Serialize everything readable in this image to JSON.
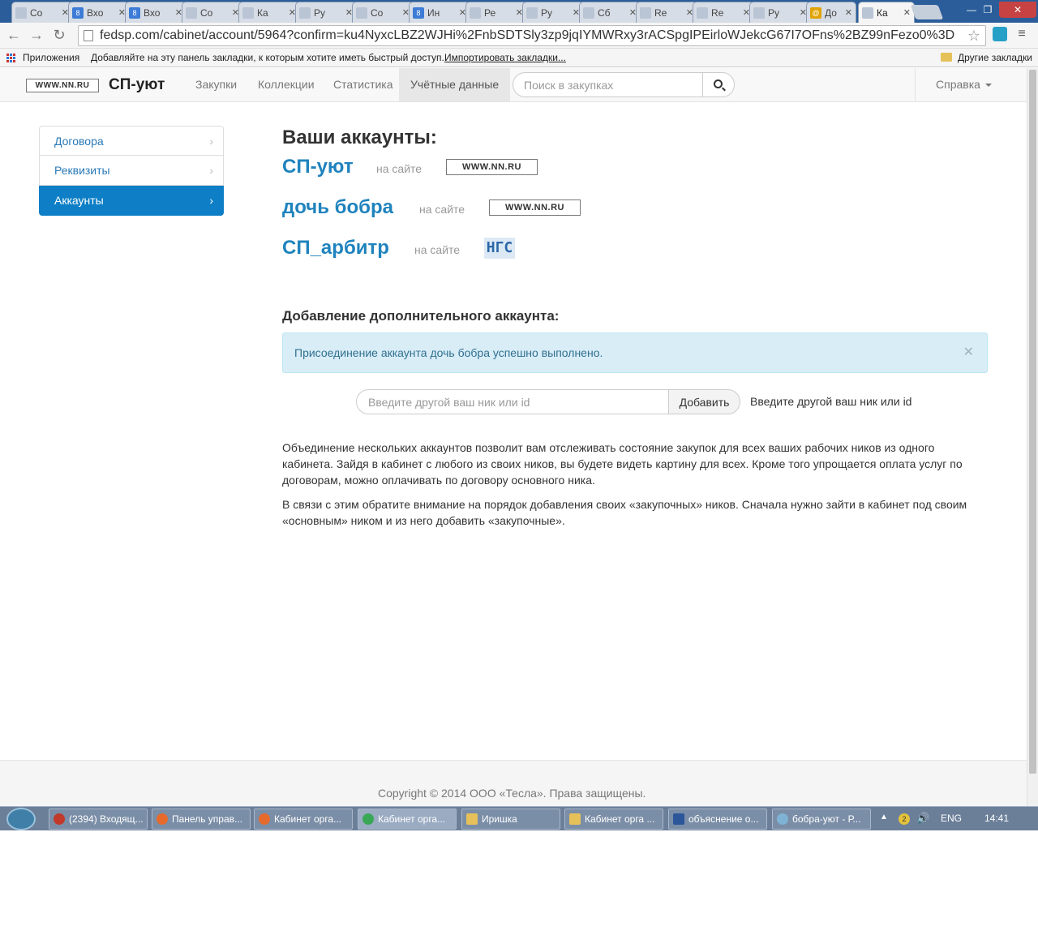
{
  "browser": {
    "tabs": [
      {
        "label": "Со",
        "icon": "page-icon"
      },
      {
        "label": "Вхо",
        "icon": "mail-icon"
      },
      {
        "label": "Вхо",
        "icon": "mail-icon"
      },
      {
        "label": "Со",
        "icon": "page-icon"
      },
      {
        "label": "Ка",
        "icon": "cart-icon"
      },
      {
        "label": "Ру",
        "icon": "page-icon"
      },
      {
        "label": "Со",
        "icon": "page-icon"
      },
      {
        "label": "Ин",
        "icon": "mail-icon"
      },
      {
        "label": "Ре",
        "icon": "document-icon"
      },
      {
        "label": "Ру",
        "icon": "page-icon"
      },
      {
        "label": "Сб",
        "icon": "page-icon"
      },
      {
        "label": "Re",
        "icon": "page-icon"
      },
      {
        "label": "Re",
        "icon": "page-icon"
      },
      {
        "label": "Ру",
        "icon": "page-icon"
      },
      {
        "label": "До",
        "icon": "at-icon"
      },
      {
        "label": "Ка",
        "icon": "cart-icon"
      }
    ],
    "url": "fedsp.com/cabinet/account/5964?confirm=ku4NyxcLBZ2WJHi%2FnbSDTSly3zp9jqIYMWRxy3rACSpgIPEirloWJekcG67I7OFns%2BZ99nFezo0%3D",
    "bookmarks": {
      "apps": "Приложения",
      "hint": "Добавляйте на эту панель закладки, к которым хотите иметь быстрый доступ.",
      "import": "Импортировать закладки...",
      "other": "Другие закладки"
    }
  },
  "navbar": {
    "logo_text": "WWW.NN.RU",
    "brand": "СП-уют",
    "items": [
      "Закупки",
      "Коллекции",
      "Статистика",
      "Учётные данные"
    ],
    "active_item": "Учётные данные",
    "search_placeholder": "Поиск в закупках",
    "help": "Справка"
  },
  "sidebar": {
    "items": [
      "Договора",
      "Реквизиты",
      "Аккаунты"
    ],
    "active": "Аккаунты"
  },
  "main": {
    "heading": "Ваши аккаунты:",
    "site_label": "на сайте",
    "accounts": [
      {
        "name": "СП-уют",
        "site_logo": "WWW.NN.RU"
      },
      {
        "name": "дочь бобра",
        "site_logo": "WWW.NN.RU"
      },
      {
        "name": "СП_арбитр",
        "site_logo": "НГС"
      }
    ],
    "add_heading": "Добавление дополнительного аккаунта:",
    "alert": "Присоединение аккаунта дочь бобра успешно выполнено.",
    "input_placeholder": "Введите другой ваш ник или id",
    "add_button": "Добавить",
    "add_hint": "Введите другой ваш ник или id",
    "para1": "Объединение нескольких аккаунтов позволит вам отслеживать состояние закупок для всех ваших рабочих ников из одного кабинета. Зайдя в кабинет с любого из своих ников, вы будете видеть картину для всех. Кроме того упрощается оплата услуг по договорам, можно оплачивать по договору основного ника.",
    "para2": "В связи с этим обратите внимание на порядок добавления своих «закупочных» ников. Сначала нужно зайти в кабинет под своим «основным» ником и из него добавить «закупочные»."
  },
  "footer": {
    "copyright": "Copyright © 2014 ООО «Тесла». Права защищены."
  },
  "taskbar": {
    "items": [
      "(2394) Входящ...",
      "Панель управ...",
      "Кабинет орга...",
      "Кабинет орга...",
      "Иришка",
      "Кабинет орга ...",
      "объяснение о...",
      "бобра-уют - Р..."
    ],
    "tray_badge": "2",
    "lang": "ENG",
    "clock": "14:41"
  }
}
